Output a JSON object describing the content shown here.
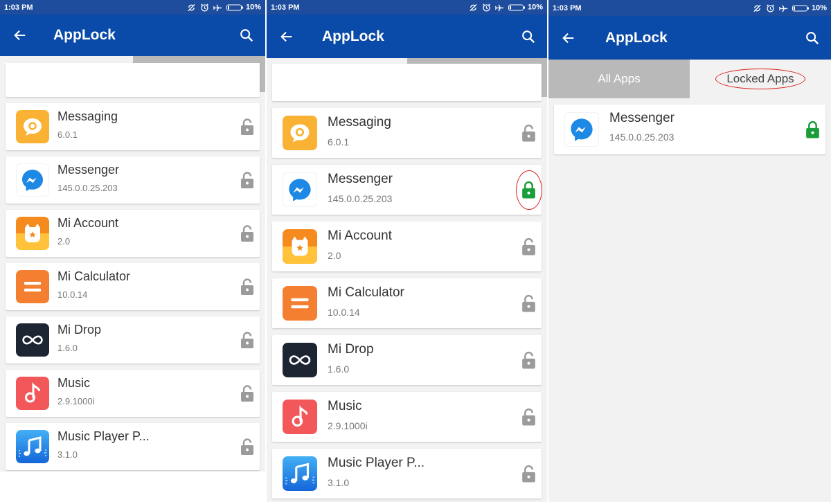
{
  "status": {
    "time": "1:03 PM",
    "battery": "10%",
    "battery_level": 0.1
  },
  "appbar": {
    "title": "AppLock"
  },
  "tabs": {
    "all": "All Apps",
    "locked": "Locked Apps"
  },
  "apps": [
    {
      "name": "Messaging",
      "version": "6.0.1",
      "icon": "messaging-icon",
      "color": "#f9b233"
    },
    {
      "name": "Messenger",
      "version": "145.0.0.25.203",
      "icon": "messenger-icon",
      "color": "#1e88e5"
    },
    {
      "name": "Mi Account",
      "version": "2.0",
      "icon": "mi-account-icon",
      "color": "#f58a1f"
    },
    {
      "name": "Mi Calculator",
      "version": "10.0.14",
      "icon": "calculator-icon",
      "color": "#f57f30"
    },
    {
      "name": "Mi Drop",
      "version": "1.6.0",
      "icon": "mi-drop-icon",
      "color": "#1d2533"
    },
    {
      "name": "Music",
      "version": "2.9.1000i",
      "icon": "music-icon",
      "color": "#f2575a"
    },
    {
      "name": "Music Player P...",
      "version": "3.1.0",
      "icon": "music-player-icon",
      "color": "#1a80e5"
    }
  ],
  "colors": {
    "status_bar": "#1e4d9e",
    "app_bar": "#0a4aa8",
    "locked": "#1a9e3a",
    "unlocked": "#9b9b9b",
    "highlight": "#d9201c"
  },
  "screens": [
    {
      "id": "screen-1",
      "active_tab": "all",
      "locked": []
    },
    {
      "id": "screen-2",
      "active_tab": "all",
      "locked": [
        "Messenger"
      ]
    },
    {
      "id": "screen-3",
      "active_tab": "locked",
      "items": [
        "Messenger"
      ]
    }
  ]
}
